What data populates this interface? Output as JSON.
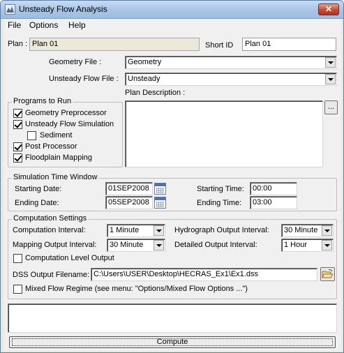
{
  "window": {
    "title": "Unsteady Flow Analysis",
    "close_glyph": "✕"
  },
  "menu": {
    "file": "File",
    "options": "Options",
    "help": "Help"
  },
  "plan": {
    "plan_label": "Plan :",
    "plan_value": "Plan 01",
    "short_id_label": "Short ID",
    "short_id_value": "Plan 01"
  },
  "geometry": {
    "label": "Geometry File :",
    "value": "Geometry"
  },
  "unsteady": {
    "label": "Unsteady Flow File :",
    "value": "Unsteady"
  },
  "programs": {
    "title": "Programs to Run",
    "items": [
      {
        "label": "Geometry Preprocessor",
        "checked": true
      },
      {
        "label": "Unsteady Flow Simulation",
        "checked": true
      },
      {
        "label": "Sediment",
        "checked": false
      },
      {
        "label": "Post Processor",
        "checked": true
      },
      {
        "label": "Floodplain Mapping",
        "checked": true
      }
    ]
  },
  "plan_description": {
    "label": "Plan Description :",
    "value": "",
    "button": "..."
  },
  "simulation": {
    "title": "Simulation Time Window",
    "starting_date_label": "Starting Date:",
    "starting_date": "01SEP2008",
    "ending_date_label": "Ending Date:",
    "ending_date": "05SEP2008",
    "starting_time_label": "Starting Time:",
    "starting_time": "00:00",
    "ending_time_label": "Ending Time:",
    "ending_time": "03:00"
  },
  "computation": {
    "title": "Computation Settings",
    "computation_interval_label": "Computation Interval:",
    "computation_interval": "1 Minute",
    "hydrograph_interval_label": "Hydrograph Output Interval:",
    "hydrograph_interval": "30 Minute",
    "mapping_interval_label": "Mapping Output Interval:",
    "mapping_interval": "30 Minute",
    "detailed_interval_label": "Detailed Output Interval:",
    "detailed_interval": "1 Hour",
    "computation_level_label": "Computation Level Output",
    "computation_level_checked": false,
    "dss_label": "DSS Output Filename:",
    "dss_value": "C:\\Users\\USER\\Desktop\\HECRAS_Ex1\\Ex1.dss",
    "mixed_flow_label": "Mixed Flow Regime (see menu: \"Options/Mixed Flow Options ...\")",
    "mixed_flow_checked": false
  },
  "output_box": {
    "value": ""
  },
  "compute_button": "Compute"
}
